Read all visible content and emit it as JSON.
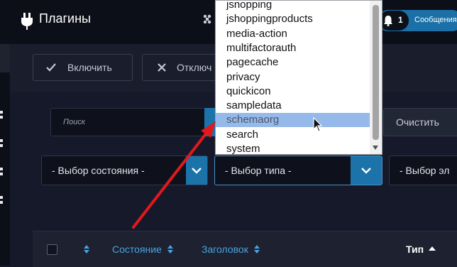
{
  "header": {
    "title": "Плагины",
    "notifications": {
      "count": "1",
      "label": "Сообщения"
    }
  },
  "toolbar": {
    "enable_label": "Включить",
    "disable_label": "Отключ"
  },
  "search": {
    "placeholder": "Поиск",
    "clear_label": "Очистить"
  },
  "filters": {
    "state": "- Выбор состояния -",
    "type": "- Выбор типа -",
    "element": "- Выбор эл"
  },
  "dropdown": {
    "options": [
      "jsnopping",
      "jshoppingproducts",
      "media-action",
      "multifactorauth",
      "pagecache",
      "privacy",
      "quickicon",
      "sampledata",
      "schemaorg",
      "search",
      "system"
    ],
    "highlighted": "schemaorg"
  },
  "table": {
    "columns": {
      "state": "Состояние",
      "title": "Заголовок",
      "type": "Тип"
    }
  },
  "colors": {
    "accent": "#1b73aa",
    "header_bg": "#0d0f18",
    "page_bg": "#16192a",
    "annotation_arrow": "#e0191c"
  }
}
